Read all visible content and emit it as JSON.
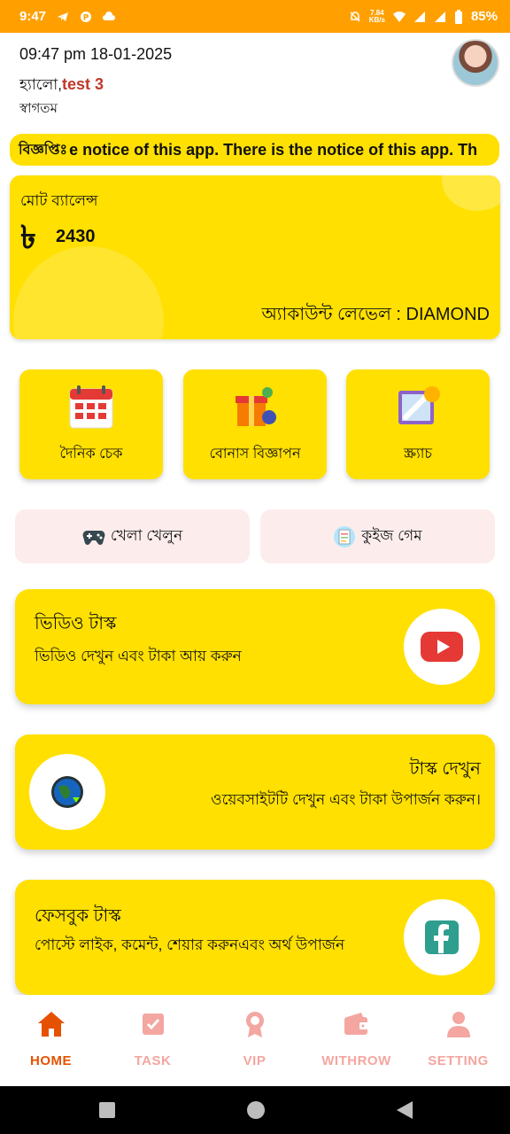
{
  "status_bar": {
    "time": "9:47",
    "net_speed_value": "7.84",
    "net_speed_unit": "KB/s",
    "battery": "85%"
  },
  "header": {
    "datetime": "09:47 pm 18-01-2025",
    "greeting": "হ্যালো,",
    "username": "test 3",
    "welcome": "স্বাগতম"
  },
  "notice": {
    "label": "বিজ্ঞপ্তিঃ",
    "text": "e notice of this app. There is the notice of this app. Th"
  },
  "balance_card": {
    "label": "মোট ব্যালেন্স",
    "currency_symbol": "৳",
    "amount": "2430",
    "level_text": "অ্যাকাউন্ট লেভেল : DIAMOND"
  },
  "features": [
    {
      "label": "দৈনিক চেক",
      "icon": "calendar-icon"
    },
    {
      "label": "বোনাস বিজ্ঞাপন",
      "icon": "gift-icon"
    },
    {
      "label": "স্ক্র্যাচ",
      "icon": "scratch-card-icon"
    }
  ],
  "secondary_buttons": [
    {
      "label": "খেলা খেলুন",
      "icon": "gamepad-icon"
    },
    {
      "label": "কুইজ গেম",
      "icon": "quiz-icon"
    }
  ],
  "tasks": [
    {
      "title": "ভিডিও টাস্ক",
      "subtitle": "ভিডিও দেখুন এবং টাকা আয় করুন",
      "icon": "youtube-icon"
    },
    {
      "title": "টাস্ক দেখুন",
      "subtitle": "ওয়েবসাইটটি দেখুন এবং টাকা উপার্জন করুন।",
      "icon": "globe-icon"
    },
    {
      "title": "ফেসবুক টাস্ক",
      "subtitle": "পোস্টে লাইক, কমেন্ট, শেয়ার করুনএবং অর্থ উপার্জন",
      "icon": "facebook-icon"
    }
  ],
  "bottom_nav": [
    {
      "label": "HOME",
      "icon": "home-icon",
      "active": true
    },
    {
      "label": "TASK",
      "icon": "task-icon",
      "active": false
    },
    {
      "label": "VIP",
      "icon": "vip-badge-icon",
      "active": false
    },
    {
      "label": "WITHROW",
      "icon": "wallet-icon",
      "active": false
    },
    {
      "label": "SETTING",
      "icon": "user-icon",
      "active": false
    }
  ],
  "colors": {
    "status_bar": "#FFA000",
    "card_yellow": "#FFE000",
    "secondary_button_bg": "#FCEDEC",
    "username_color": "#C0392B",
    "nav_active": "#E65100",
    "nav_inactive": "#F4A6A0"
  }
}
